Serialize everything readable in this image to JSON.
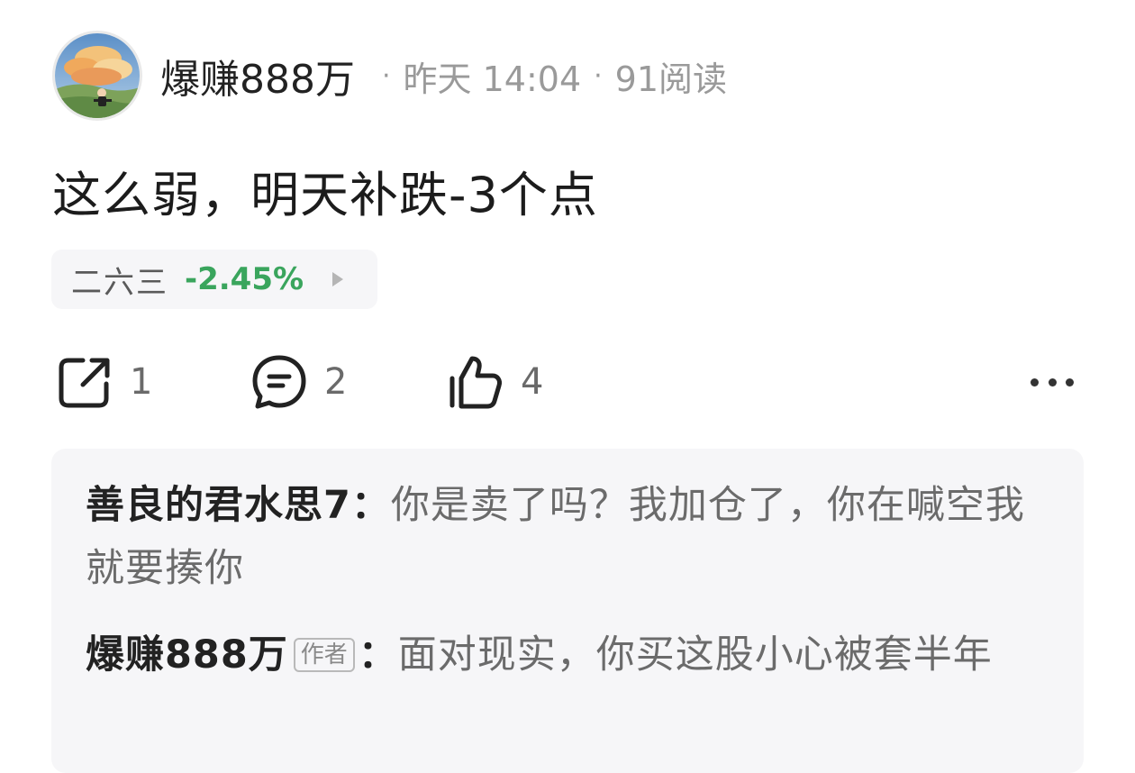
{
  "post": {
    "username": "爆赚888万",
    "time": "昨天 14:04",
    "reads": "91阅读",
    "separator": "·",
    "text": "这么弱，明天补跌-3个点"
  },
  "stock": {
    "name": "二六三",
    "change": "-2.45%",
    "change_color": "#3aa55d"
  },
  "actions": {
    "share_count": "1",
    "comment_count": "2",
    "like_count": "4",
    "share_icon": "share-icon",
    "comment_icon": "comment-icon",
    "like_icon": "thumbs-up-icon",
    "more_icon": "more-icon"
  },
  "comments": [
    {
      "name": "善良的君水思7",
      "colon": "：",
      "text": "你是卖了吗？我加仓了，你在喊空我就要揍你"
    },
    {
      "name": "爆赚888万",
      "badge": "作者",
      "colon": "：",
      "text": "面对现实，你买这股小心被套半年"
    }
  ]
}
